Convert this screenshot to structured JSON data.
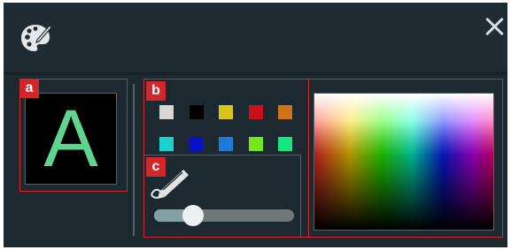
{
  "callouts": [
    "a",
    "b",
    "c"
  ],
  "preview": {
    "letter": "A",
    "letter_color": "#5fd48f",
    "background": "#000000"
  },
  "swatches": [
    {
      "color": "#d7d7d7"
    },
    {
      "color": "#000000"
    },
    {
      "color": "#d6c818"
    },
    {
      "color": "#c8101c"
    },
    {
      "color": "#d07318"
    },
    {
      "color": "#1ad2d2"
    },
    {
      "color": "#0a10c8"
    },
    {
      "color": "#1e7ad8"
    },
    {
      "color": "#78e61a"
    },
    {
      "color": "#16e682"
    }
  ],
  "stroke_width": {
    "level": 0.24
  },
  "icons": {
    "header": "palette-icon",
    "close": "close-icon",
    "stroke": "brush-stroke-icon"
  },
  "colors": {
    "panel": "#1e2a31",
    "callout": "#d3262b",
    "close": "#d7dde0"
  }
}
